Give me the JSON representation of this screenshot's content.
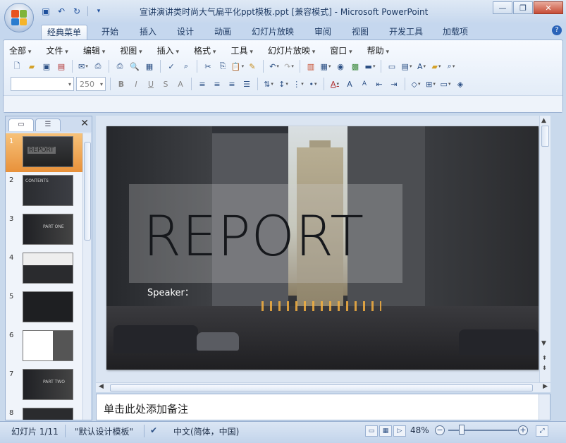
{
  "window": {
    "title": "宣讲演讲类时尚大气扁平化ppt模板.ppt [兼容模式] - Microsoft PowerPoint",
    "minimize_icon": "minimize-icon",
    "restore_icon": "restore-icon",
    "close_icon": "close-icon"
  },
  "quick_access": [
    "save-icon",
    "undo-icon",
    "redo-icon",
    "customize-icon"
  ],
  "ribbon_tabs": [
    "经典菜单",
    "开始",
    "插入",
    "设计",
    "动画",
    "幻灯片放映",
    "审阅",
    "视图",
    "开发工具",
    "加载项"
  ],
  "active_tab": "经典菜单",
  "menus": [
    "全部",
    "文件",
    "编辑",
    "视图",
    "插入",
    "格式",
    "工具",
    "幻灯片放映",
    "窗口",
    "帮助"
  ],
  "toolbar": {
    "font_name": "",
    "font_size": "250"
  },
  "slides_panel": {
    "tabs": [
      "slides-tab",
      "outline-tab"
    ],
    "thumbnails": [
      {
        "num": "1",
        "label": "REPORT",
        "selected": true
      },
      {
        "num": "2",
        "label": "CONTENTS",
        "selected": false
      },
      {
        "num": "3",
        "label": "PART ONE",
        "selected": false
      },
      {
        "num": "4",
        "label": "",
        "selected": false
      },
      {
        "num": "5",
        "label": "",
        "selected": false
      },
      {
        "num": "6",
        "label": "",
        "selected": false
      },
      {
        "num": "7",
        "label": "PART TWO",
        "selected": false
      },
      {
        "num": "8",
        "label": "",
        "selected": false
      }
    ]
  },
  "slide": {
    "title": "REPORT",
    "speaker": "Speaker："
  },
  "notes": {
    "placeholder": "单击此处添加备注"
  },
  "status": {
    "slide_count": "幻灯片 1/11",
    "theme": "\"默认设计模板\"",
    "language": "中文(简体，中国)",
    "zoom": "48%"
  },
  "colors": {
    "accent": "#e8913a",
    "ribbon_bg": "#dde8f5",
    "title_text": "#1f3b64"
  }
}
